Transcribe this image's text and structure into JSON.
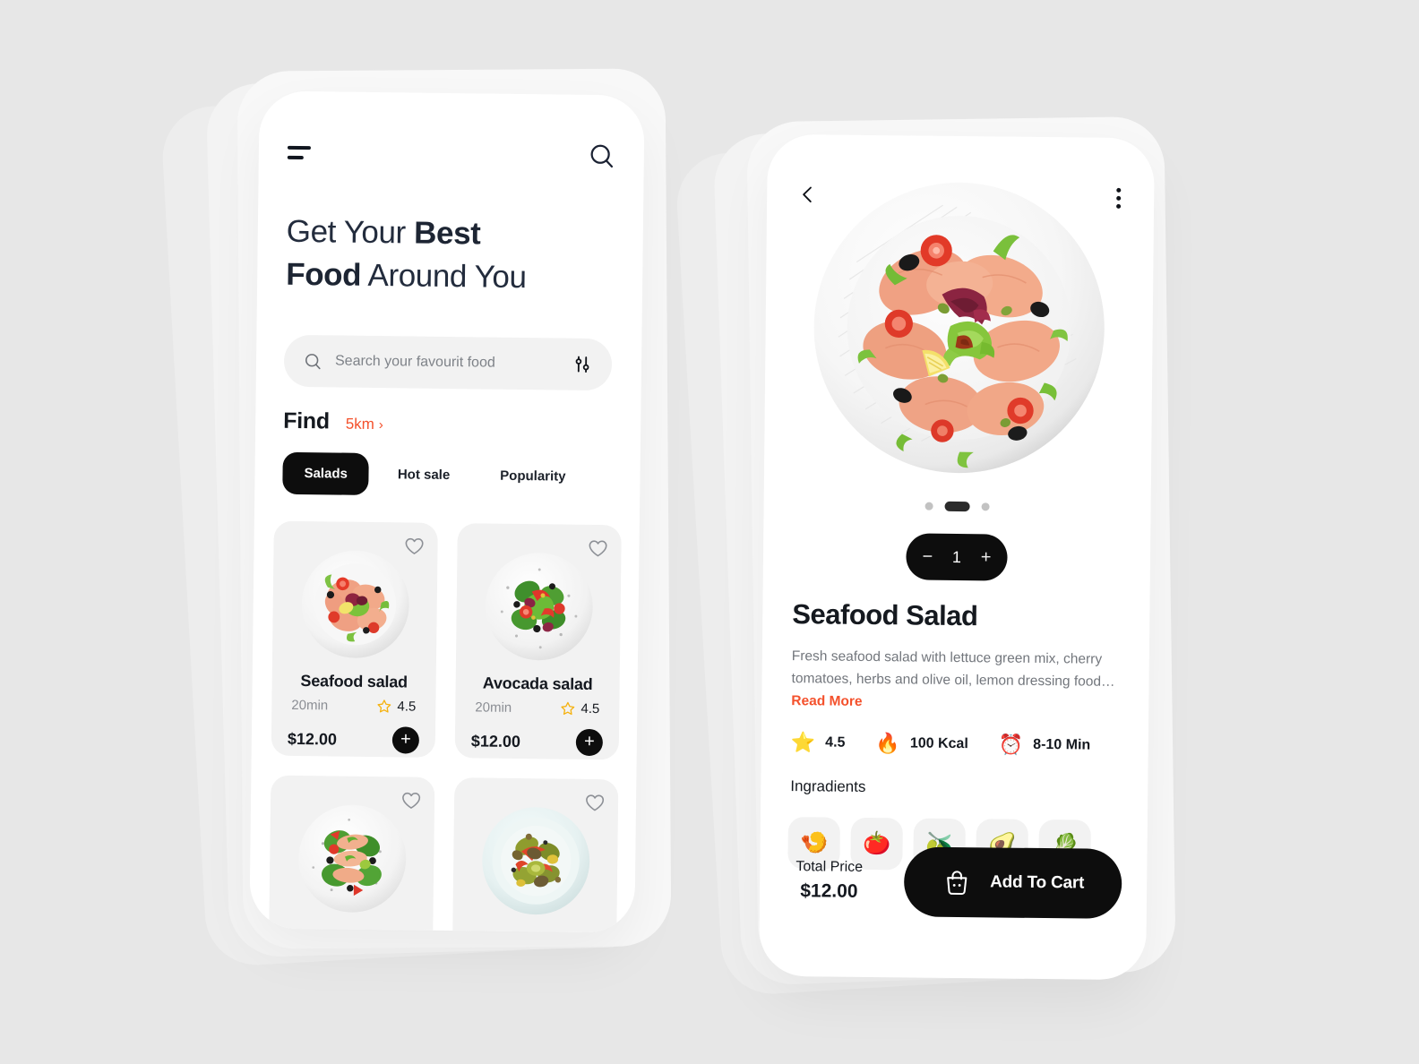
{
  "theme": {
    "background": "#e7e7e7",
    "surface": "#ffffff",
    "muted_surface": "#f2f2f2",
    "ink": "#15191f",
    "ink_soft": "#72767c",
    "accent": "#f4512c",
    "dark": "#0d0d0d",
    "star": "#ffc107"
  },
  "home": {
    "menu_icon": "hamburger-icon",
    "search_icon": "search-icon",
    "headline_part1": "Get Your ",
    "headline_bold1": "Best",
    "headline_part2": "",
    "headline_bold2": "Food",
    "headline_part3": " Around You",
    "search": {
      "placeholder": "Search your favourit food",
      "value": "",
      "leading_icon": "search-icon",
      "trailing_icon": "filter-sliders-icon"
    },
    "find": {
      "label": "Find",
      "distance": "5km",
      "chevron": "›"
    },
    "tabs": [
      {
        "label": "Salads",
        "active": true
      },
      {
        "label": "Hot sale",
        "active": false
      },
      {
        "label": "Popularity",
        "active": false
      }
    ],
    "cards": [
      {
        "name": "Seafood salad",
        "time": "20min",
        "rating": "4.5",
        "price": "$12.00",
        "fav_icon": "heart-outline-icon",
        "add_icon": "plus-icon",
        "thumb": "seafood-salad-plate"
      },
      {
        "name": "Avocada salad",
        "time": "20min",
        "rating": "4.5",
        "price": "$12.00",
        "fav_icon": "heart-outline-icon",
        "add_icon": "plus-icon",
        "thumb": "avocado-salad-plate"
      },
      {
        "name": "",
        "time": "",
        "rating": "",
        "price": "",
        "fav_icon": "heart-outline-icon",
        "add_icon": "plus-icon",
        "thumb": "chicken-salad-plate"
      },
      {
        "name": "",
        "time": "",
        "rating": "",
        "price": "",
        "fav_icon": "heart-outline-icon",
        "add_icon": "plus-icon",
        "thumb": "warm-veg-salad-plate"
      }
    ]
  },
  "detail": {
    "back_icon": "chevron-left-icon",
    "more_icon": "kebab-menu-icon",
    "hero_image": "seafood-salad-plate-large",
    "carousel": {
      "dots": 3,
      "active_index": 1
    },
    "quantity": {
      "minus": "−",
      "value": "1",
      "plus": "+"
    },
    "title": "Seafood Salad",
    "description": "Fresh seafood  salad with lettuce green mix, cherry tomatoes, herbs and olive oil, lemon dressing food…",
    "read_more": "Read More",
    "stats": [
      {
        "icon": "star-icon",
        "glyph": "⭐",
        "value": "4.5"
      },
      {
        "icon": "fire-icon",
        "glyph": "🔥",
        "value": "100 Kcal"
      },
      {
        "icon": "alarm-clock-icon",
        "glyph": "⏰",
        "value": "8-10 Min"
      }
    ],
    "ingredients_title": "Ingradients",
    "ingredients": [
      {
        "icon": "shrimp-icon",
        "glyph": "🍤"
      },
      {
        "icon": "tomato-icon",
        "glyph": "🍅"
      },
      {
        "icon": "olives-icon",
        "glyph": "🫒"
      },
      {
        "icon": "avocado-icon",
        "glyph": "🥑"
      },
      {
        "icon": "lettuce-icon",
        "glyph": "🥬"
      }
    ],
    "total_label": "Total Price",
    "total_price": "$12.00",
    "cart_button": {
      "label": "Add To Cart",
      "icon": "shopping-bag-icon"
    }
  }
}
